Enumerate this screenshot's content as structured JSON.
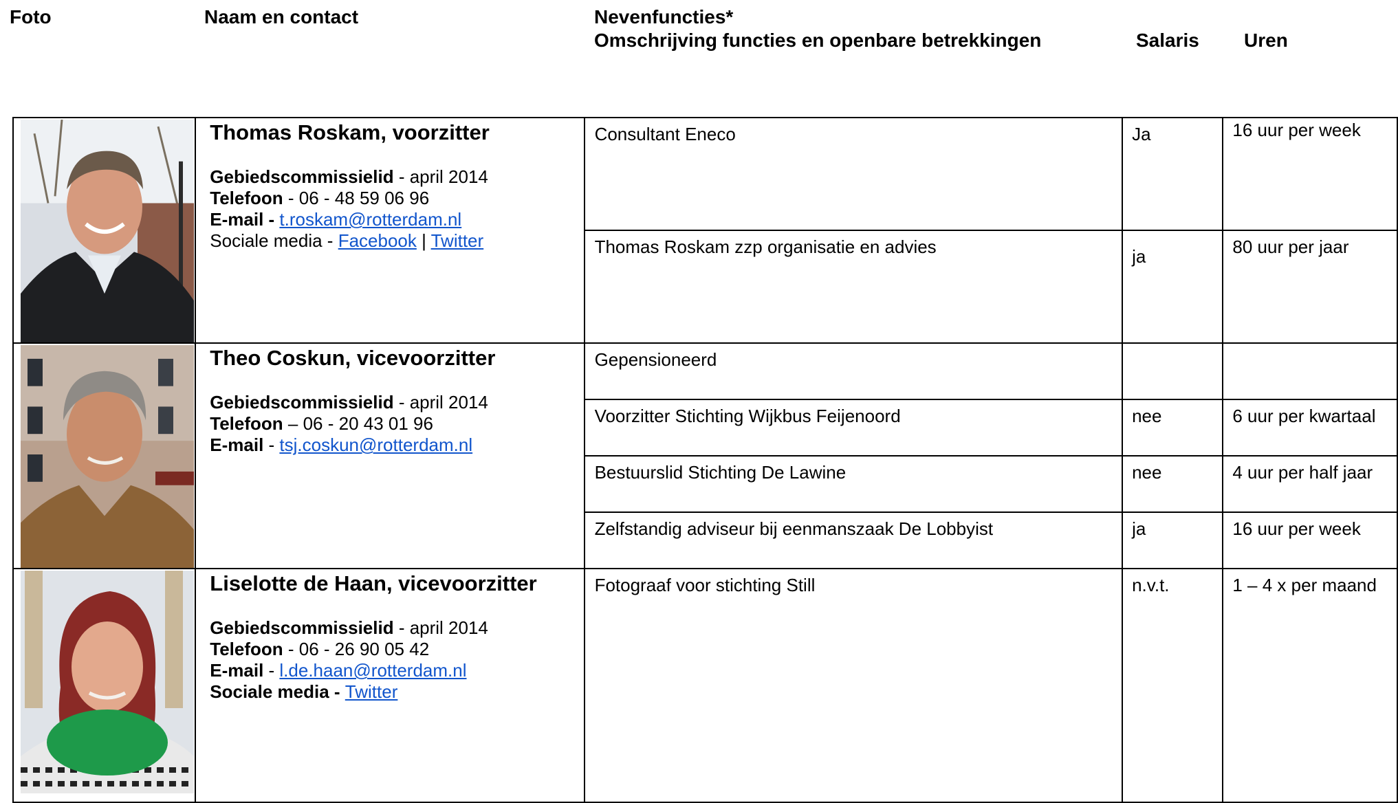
{
  "header": {
    "foto": "Foto",
    "naam": "Naam en contact",
    "nevenfuncties": "Nevenfuncties*",
    "omschrijving": "Omschrijving functies en openbare betrekkingen",
    "salaris": "Salaris",
    "uren": "Uren"
  },
  "members": [
    {
      "name": "Thomas Roskam, voorzitter",
      "role_label": "Gebiedscommissielid",
      "role_value": " - april 2014",
      "phone_label": "Telefoon",
      "phone_value": " - 06 - 48 59 06 96",
      "email_label": "E-mail - ",
      "email": "t.roskam@rotterdam.nl",
      "social_label": "Sociale media - ",
      "facebook": "Facebook",
      "sep": " | ",
      "twitter": "Twitter",
      "functions": [
        {
          "omschrijving": "Consultant Eneco",
          "salaris": "Ja",
          "uren": "16 uur per week"
        },
        {
          "omschrijving": "Thomas Roskam zzp organisatie en advies",
          "salaris": "ja",
          "uren": "80 uur per jaar"
        }
      ]
    },
    {
      "name": "Theo Coskun, vicevoorzitter",
      "role_label": "Gebiedscommissielid",
      "role_value": " - april 2014",
      "phone_label": "Telefoon",
      "phone_value": " – 06 - 20 43 01 96",
      "email_label": "E-mail",
      "email_sep": " - ",
      "email": "tsj.coskun@rotterdam.nl",
      "functions": [
        {
          "omschrijving": "Gepensioneerd",
          "salaris": "",
          "uren": ""
        },
        {
          "omschrijving": "Voorzitter Stichting Wijkbus Feijenoord",
          "salaris": "nee",
          "uren": "6 uur per kwartaal"
        },
        {
          "omschrijving": "Bestuurslid Stichting De Lawine",
          "salaris": "nee",
          "uren": "4 uur per half jaar"
        },
        {
          "omschrijving": "Zelfstandig adviseur bij eenmanszaak De Lobbyist",
          "salaris": "ja",
          "uren": "16 uur per week"
        }
      ]
    },
    {
      "name": "Liselotte de Haan, vicevoorzitter",
      "role_label": "Gebiedscommissielid",
      "role_value": " - april 2014",
      "phone_label": "Telefoon",
      "phone_value": " - 06 - 26 90 05 42",
      "email_label": "E-mail",
      "email_sep": " - ",
      "email": "l.de.haan@rotterdam.nl",
      "social_label": "Sociale media - ",
      "twitter": "Twitter",
      "functions": [
        {
          "omschrijving": "Fotograaf voor stichting Still",
          "salaris": "n.v.t.",
          "uren": "1 – 4 x per maand"
        }
      ]
    }
  ]
}
